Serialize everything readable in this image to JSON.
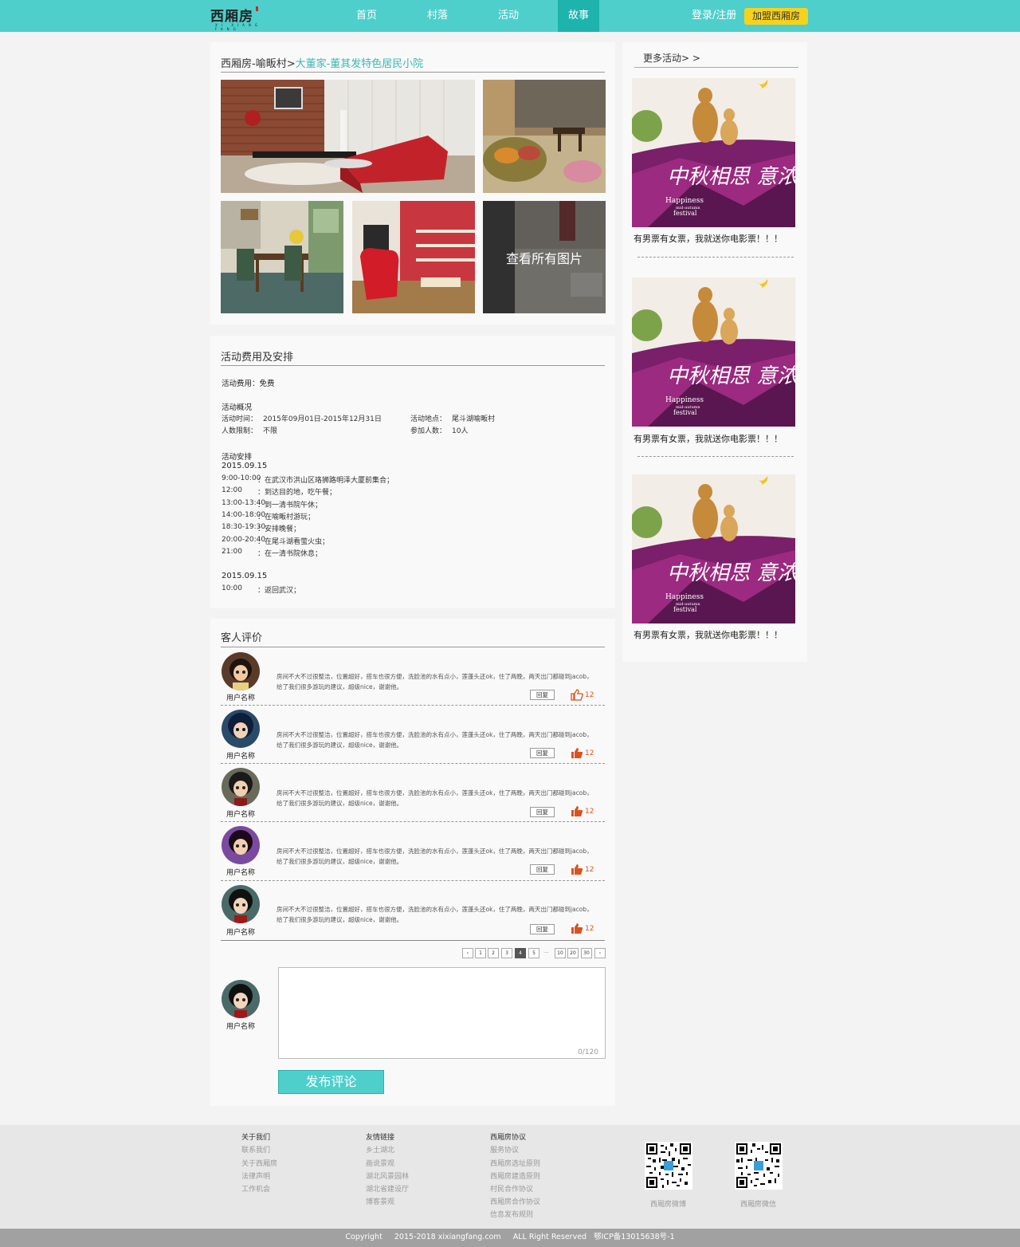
{
  "header": {
    "logo": "西厢房",
    "logo_sub": "XI XIANG FANG",
    "nav": [
      "首页",
      "村落",
      "活动",
      "故事"
    ],
    "active_nav": "故事",
    "login": "登录/注册",
    "join": "加盟西厢房"
  },
  "gallery": {
    "crumb_prefix": "西厢房-喻畈村>",
    "crumb_title": "大董家-董其发特色居民小院",
    "view_all": "查看所有图片"
  },
  "info": {
    "title": "活动费用及安排",
    "fee": "活动费用：免费",
    "overview_title": "活动概况",
    "time_label": "活动时间：",
    "time_value": "2015年09月01日-2015年12月31日",
    "place_label": "活动地点：",
    "place_value": "尾斗湖喻畈村",
    "limit_label": "人数限制：",
    "limit_value": "不限",
    "joined_label": "参加人数：",
    "joined_value": "10人",
    "plan_title": "活动安排",
    "day1": "2015.09.15",
    "schedule": [
      {
        "time": "9:00-10:00",
        "desc": "：在武汉市洪山区珞狮路明泽大厦前集合；"
      },
      {
        "time": "12:00",
        "desc": "：到达目的地，吃午餐；"
      },
      {
        "time": "13:00-13:40",
        "desc": "：到一清书院午休；"
      },
      {
        "time": "14:00-18:00",
        "desc": "：在喻畈村游玩；"
      },
      {
        "time": "18:30-19:30",
        "desc": "：安排晚餐；"
      },
      {
        "time": "20:00-20:40",
        "desc": "：在尾斗湖看萤火虫；"
      },
      {
        "time": "21:00",
        "desc": "：在一清书院休息；"
      }
    ],
    "day2": "2015.09.15",
    "schedule2": [
      {
        "time": "10:00",
        "desc": "：返回武汉；"
      }
    ]
  },
  "reviews": {
    "title": "客人评价",
    "items": [
      {
        "user": "用户名称",
        "line1": "房间不大不过很整洁，位置超好，搭车也很方便，洗脸池的水有点小，莲蓬头还ok，住了两晚，两天出门都碰到jacob，",
        "line2": "给了我们很多游玩的建议，超级nice，谢谢他。",
        "reply": "回复",
        "likes": "12",
        "liked": false
      },
      {
        "user": "用户名称",
        "line1": "房间不大不过很整洁，位置超好，搭车也很方便，洗脸池的水有点小，莲蓬头还ok，住了两晚，两天出门都碰到jacob，",
        "line2": "给了我们很多游玩的建议，超级nice，谢谢他。",
        "reply": "回复",
        "likes": "12",
        "liked": true
      },
      {
        "user": "用户名称",
        "line1": "房间不大不过很整洁，位置超好，搭车也很方便，洗脸池的水有点小，莲蓬头还ok，住了两晚，两天出门都碰到jacob，",
        "line2": "给了我们很多游玩的建议，超级nice，谢谢他。",
        "reply": "回复",
        "likes": "12",
        "liked": true
      },
      {
        "user": "用户名称",
        "line1": "房间不大不过很整洁，位置超好，搭车也很方便，洗脸池的水有点小，莲蓬头还ok，住了两晚，两天出门都碰到jacob，",
        "line2": "给了我们很多游玩的建议，超级nice，谢谢他。",
        "reply": "回复",
        "likes": "12",
        "liked": true
      },
      {
        "user": "用户名称",
        "line1": "房间不大不过很整洁，位置超好，搭车也很方便，洗脸池的水有点小，莲蓬头还ok，住了两晚，两天出门都碰到jacob，",
        "line2": "给了我们很多游玩的建议，超级nice，谢谢他。",
        "reply": "回复",
        "likes": "12",
        "liked": true
      }
    ],
    "pagination": [
      "‹",
      "1",
      "2",
      "3",
      "4",
      "5",
      "...",
      "10",
      "20",
      "30",
      "›"
    ],
    "current_page": "4",
    "composer_user": "用户名称",
    "counter": "0/120",
    "post": "发布评论"
  },
  "sidebar": {
    "title": "更多活动> >",
    "ads": [
      {
        "caption": "有男票有女票，我就送你电影票！！！",
        "brush": "中秋相思 意浓浓",
        "en1": "Happiness",
        "en2": "mid-autumn",
        "en3": "festival"
      },
      {
        "caption": "有男票有女票，我就送你电影票！！！",
        "brush": "中秋相思 意浓浓",
        "en1": "Happiness",
        "en2": "mid-autumn",
        "en3": "festival"
      },
      {
        "caption": "有男票有女票，我就送你电影票！！！",
        "brush": "中秋相思 意浓浓",
        "en1": "Happiness",
        "en2": "mid-autumn",
        "en3": "festival"
      }
    ]
  },
  "footer": {
    "cols": [
      {
        "head": "关于我们",
        "links": [
          "联系我们",
          "关于西厢房",
          "法律声明",
          "工作机会"
        ]
      },
      {
        "head": "友情链接",
        "links": [
          "乡土湖北",
          "画说景观",
          "湖北风景园林",
          "湖北省建设厅",
          "博客景观"
        ]
      },
      {
        "head": "西厢房协议",
        "links": [
          "服务协议",
          "西厢房选址原则",
          "西厢房建造原则",
          "村民合作协议",
          "西厢房合作协议",
          "信息发布规则"
        ]
      }
    ],
    "qr1": "西厢房微博",
    "qr2": "西厢房微信",
    "copyright": "Copyright     2015-2018 xixiangfang.com     ALL Right Reserved   鄂ICP备13015638号-1"
  },
  "colors": {
    "accent": "#4ecfcb",
    "active": "#1eb3ad",
    "join": "#f7d21c",
    "like": "#d9531e",
    "footer": "#e7e7e7"
  }
}
